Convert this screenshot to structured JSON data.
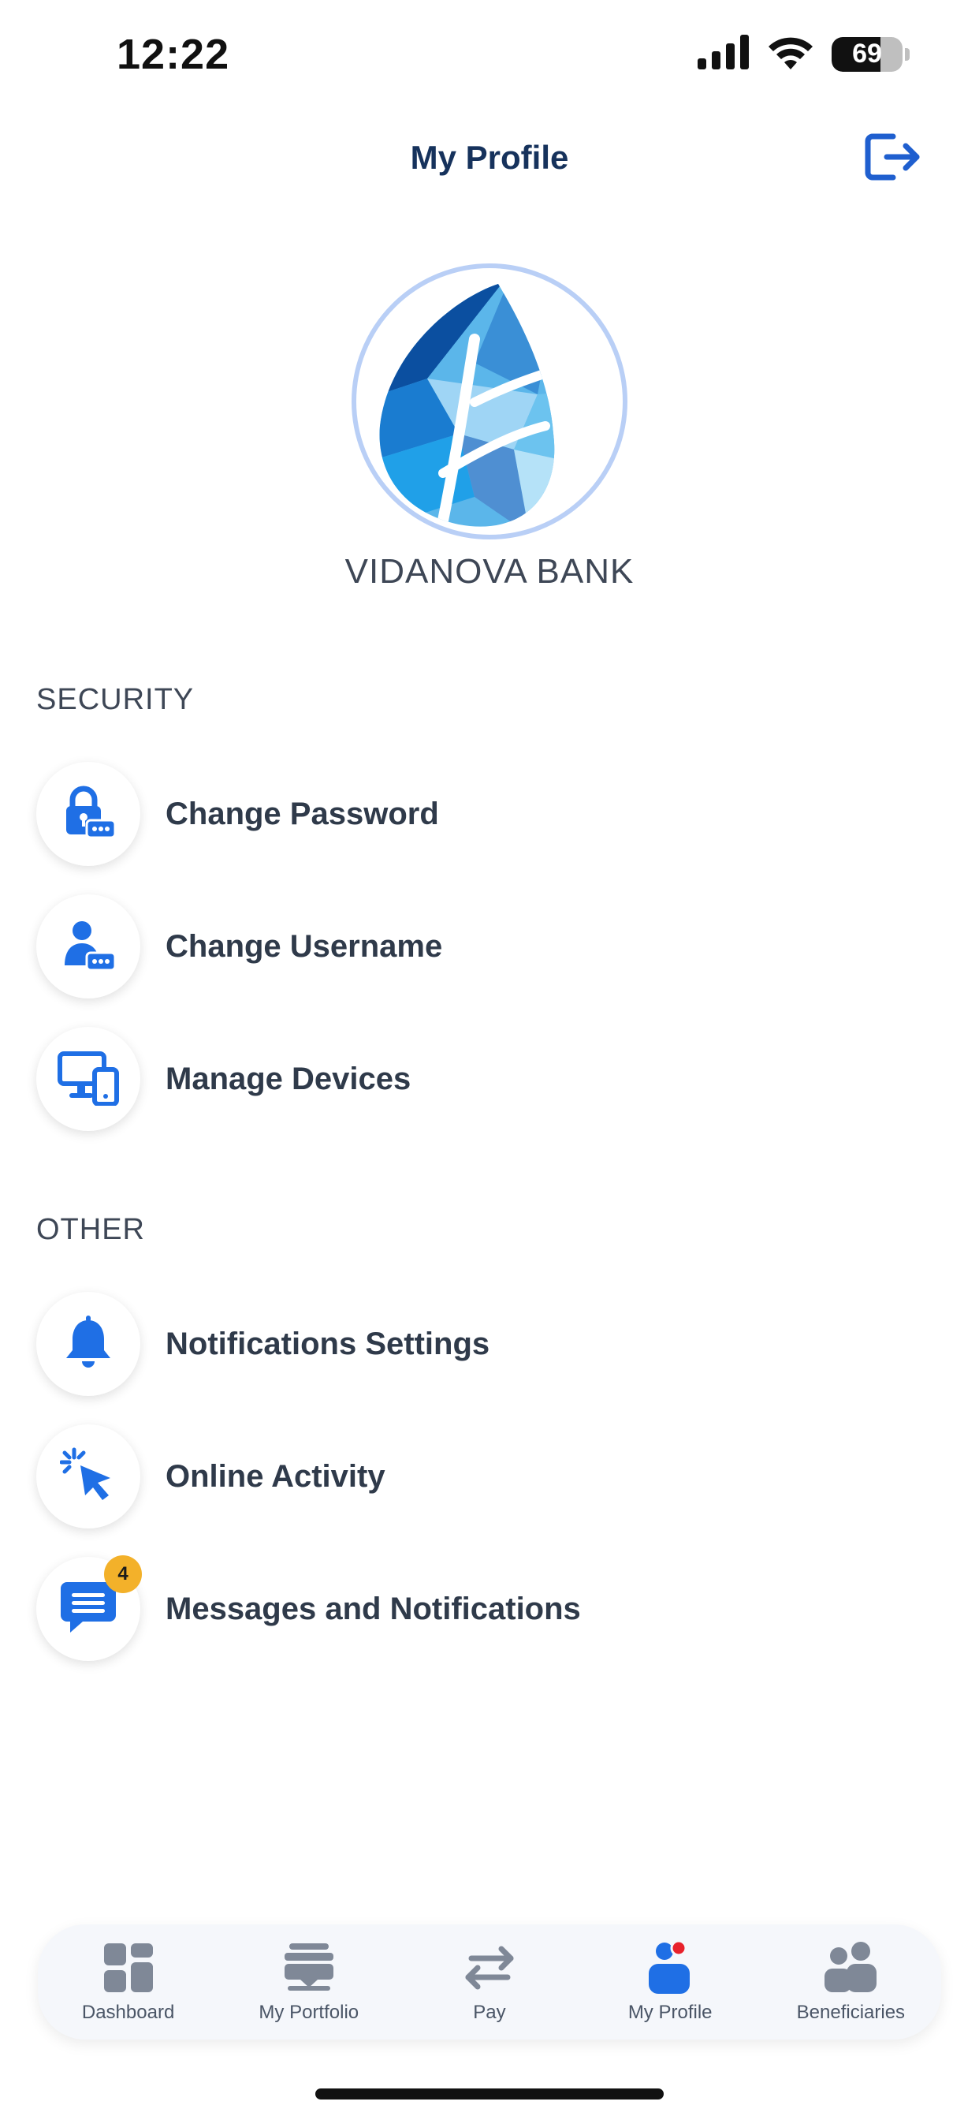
{
  "status_bar": {
    "time": "12:22",
    "battery": "69"
  },
  "header": {
    "title": "My Profile"
  },
  "profile": {
    "bank_name": "VIDANOVA BANK"
  },
  "sections": {
    "security": {
      "label": "SECURITY",
      "items": [
        {
          "label": "Change Password",
          "icon": "lock-password-icon"
        },
        {
          "label": "Change Username",
          "icon": "user-password-icon"
        },
        {
          "label": "Manage Devices",
          "icon": "devices-icon"
        }
      ]
    },
    "other": {
      "label": "OTHER",
      "items": [
        {
          "label": "Notifications Settings",
          "icon": "bell-icon"
        },
        {
          "label": "Online Activity",
          "icon": "cursor-click-icon"
        },
        {
          "label": "Messages and Notifications",
          "icon": "chat-icon",
          "badge": "4"
        }
      ]
    }
  },
  "tab_bar": {
    "items": [
      {
        "label": "Dashboard",
        "icon": "dashboard-icon",
        "active": false
      },
      {
        "label": "My Portfolio",
        "icon": "portfolio-icon",
        "active": false
      },
      {
        "label": "Pay",
        "icon": "transfer-arrows-icon",
        "active": false
      },
      {
        "label": "My Profile",
        "icon": "profile-icon",
        "active": true
      },
      {
        "label": "Beneficiaries",
        "icon": "people-icon",
        "active": false
      }
    ]
  },
  "colors": {
    "accent": "#1f6fe5",
    "title": "#16325c",
    "badge": "#f3b12a",
    "tab_inactive": "#7f8897",
    "tab_active_dot": "#e8212b"
  }
}
